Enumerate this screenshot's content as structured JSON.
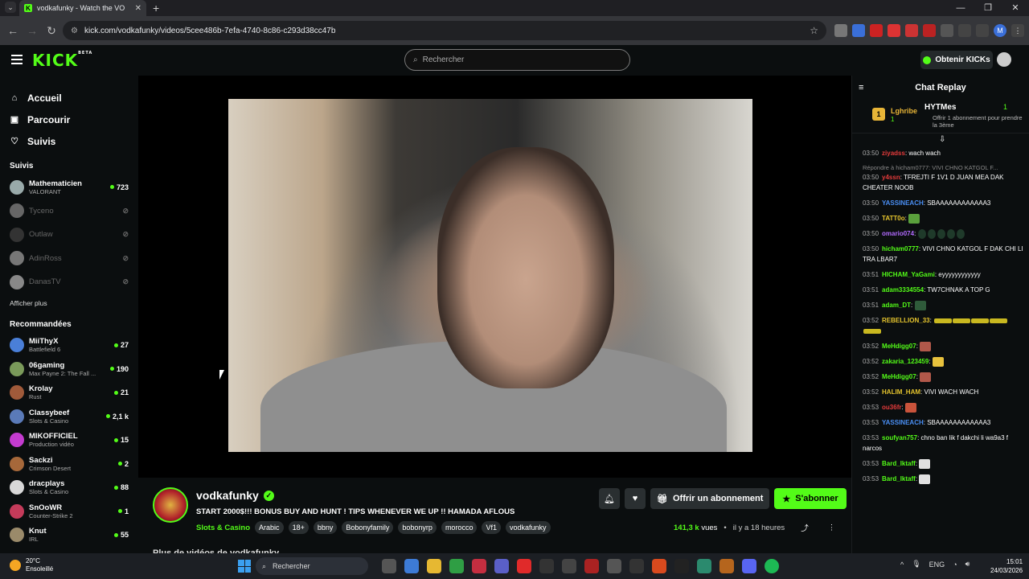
{
  "browser": {
    "tab_title": "vodkafunky - Watch the VO",
    "url": "kick.com/vodkafunky/videos/5cee486b-7efa-4740-8c86-c293d38cc47b"
  },
  "header": {
    "logo": "KICK",
    "logo_badge": "BETA",
    "search_placeholder": "Rechercher",
    "get_kicks": "Obtenir KICKs"
  },
  "sidebar": {
    "nav": [
      {
        "label": "Accueil"
      },
      {
        "label": "Parcourir"
      },
      {
        "label": "Suivis"
      }
    ],
    "following_title": "Suivis",
    "following": [
      {
        "name": "Mathematicien",
        "category": "VALORANT",
        "viewers": "723",
        "live": true
      },
      {
        "name": "Tyceno",
        "category": "",
        "viewers": "",
        "live": false
      },
      {
        "name": "Outlaw",
        "category": "",
        "viewers": "",
        "live": false
      },
      {
        "name": "AdinRoss",
        "category": "",
        "viewers": "",
        "live": false
      },
      {
        "name": "DanasTV",
        "category": "",
        "viewers": "",
        "live": false
      }
    ],
    "show_more": "Afficher plus",
    "recommended_title": "Recommandées",
    "recommended": [
      {
        "name": "MiiThyX",
        "category": "Battlefield 6",
        "viewers": "27"
      },
      {
        "name": "06gaming",
        "category": "Max Payne 2: The Fall ...",
        "viewers": "190"
      },
      {
        "name": "Krolay",
        "category": "Rust",
        "viewers": "21"
      },
      {
        "name": "Classybeef",
        "category": "Slots & Casino",
        "viewers": "2,1 k"
      },
      {
        "name": "MIKOFFICIEL",
        "category": "Production vidéo",
        "viewers": "15"
      },
      {
        "name": "Sackzi",
        "category": "Crimson Desert",
        "viewers": "2"
      },
      {
        "name": "dracplays",
        "category": "Slots & Casino",
        "viewers": "88"
      },
      {
        "name": "SnOoWR",
        "category": "Counter-Strike 2",
        "viewers": "1"
      },
      {
        "name": "Knut",
        "category": "IRL",
        "viewers": "55"
      }
    ]
  },
  "stream": {
    "streamer": "vodkafunky",
    "title": "START 2000$!!! BONUS BUY AND HUNT ! TIPS WHENEVER WE UP !! HAMADA AFLOUS",
    "category": "Slots & Casino",
    "tags": [
      "Arabic",
      "18+",
      "bbny",
      "Bobonyfamily",
      "bobonyrp",
      "morocco",
      "Vf1",
      "vodkafunky"
    ],
    "gift_sub": "Offrir un abonnement",
    "subscribe": "S'abonner",
    "views": "141,3 k",
    "views_label": "vues",
    "ago": "il y a 18 heures",
    "more_videos": "Plus de vidéos de vodkafunky"
  },
  "chat": {
    "title": "Chat Replay",
    "pinned_left": {
      "name": "Lghribe",
      "count": "1",
      "rank": "1"
    },
    "pinned_right": {
      "name": "HYTMes",
      "count": "1",
      "text": "Offrir 1 abonnement pour prendre la 3ème"
    },
    "messages": [
      {
        "time": "03:50",
        "user": "ziyadss",
        "color": "#e53b3b",
        "text": "wach wach"
      },
      {
        "reply": "Répondre à hicham0777: VIVI CHNO KATGOL F..."
      },
      {
        "time": "03:50",
        "user": "y4ssn",
        "color": "#e53b3b",
        "text": "TFREJTI F 1V1 D JUAN MEA DAK CHEATER NOOB"
      },
      {
        "time": "03:50",
        "user": "YASSINEACH",
        "color": "#4a8ff5",
        "text": "SBAAAAAAAAAAAA3"
      },
      {
        "time": "03:50",
        "user": "TATT0o",
        "color": "#e6c52e",
        "text": "",
        "emote": "#5aa03c"
      },
      {
        "time": "03:50",
        "user": "omario074",
        "color": "#b26bff",
        "text": "",
        "emote_row": true
      },
      {
        "time": "03:50",
        "user": "hicham0777",
        "color": "#53fc18",
        "text": "VIVI CHNO KATGOL F DAK CHI LI TRA LBAR7"
      },
      {
        "time": "03:51",
        "user": "HICHAM_YaGami",
        "color": "#53fc18",
        "text": "eyyyyyyyyyyyy"
      },
      {
        "time": "03:51",
        "user": "adam3334554",
        "color": "#53fc18",
        "text": "TW7CHNAK A TOP G"
      },
      {
        "time": "03:51",
        "user": "adam_DT",
        "color": "#53fc18",
        "text": "",
        "emote": "#2f5a3a"
      },
      {
        "time": "03:52",
        "user": "REBELLION_33",
        "color": "#e6c52e",
        "text": "",
        "emote_bar": true
      },
      {
        "time": "03:52",
        "user": "MeHdigg07",
        "color": "#53fc18",
        "text": "",
        "emote": "#b1584a"
      },
      {
        "time": "03:52",
        "user": "zakaria_123459",
        "color": "#53fc18",
        "text": "",
        "emote": "#e8c23d"
      },
      {
        "time": "03:52",
        "user": "MeHdigg07",
        "color": "#53fc18",
        "text": "",
        "emote": "#b1584a"
      },
      {
        "time": "03:52",
        "user": "HALIM_HAM",
        "color": "#e6c52e",
        "text": "VIVI WACH WACH"
      },
      {
        "time": "03:53",
        "user": "ou36fr",
        "color": "#e53b3b",
        "text": "",
        "emote": "#c9533b"
      },
      {
        "time": "03:53",
        "user": "YASSINEACH",
        "color": "#4a8ff5",
        "text": "SBAAAAAAAAAAAA3"
      },
      {
        "time": "03:53",
        "user": "soufyan757",
        "color": "#53fc18",
        "text": "chno ban lik f dakchi li wa9a3 f narcos"
      },
      {
        "time": "03:53",
        "user": "Bard_lktaff",
        "color": "#53fc18",
        "text": "",
        "emote": "#e0e0e0"
      },
      {
        "time": "03:53",
        "user": "Bard_lktaff",
        "color": "#53fc18",
        "text": "",
        "emote": "#e0e0e0"
      }
    ]
  },
  "taskbar": {
    "temp": "20°C",
    "weather": "Ensoleillé",
    "search": "Rechercher",
    "lang": "ENG",
    "time": "15:01",
    "date": "24/03/2026"
  }
}
